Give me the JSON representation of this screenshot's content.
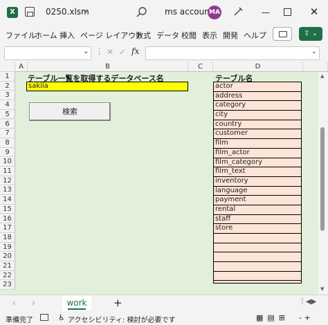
{
  "titlebar": {
    "logo": "X",
    "filename": "0250.xlsm",
    "account": "ms account",
    "avatar_initials": "MA",
    "minimize": "—",
    "close": "✕",
    "dropdown": "⌄"
  },
  "ribbon": {
    "tabs": [
      "ファイル",
      "ホーム",
      "挿入",
      "ページ レイアウト",
      "数式",
      "データ",
      "校閲",
      "表示",
      "開発",
      "ヘルプ"
    ],
    "share_label": "⇪ ⌄"
  },
  "formula_bar": {
    "name_box_value": "",
    "formula_value": "",
    "fx": "fx",
    "cancel": "✕",
    "enter": "✓",
    "dots": "⋮",
    "expand": "⌄",
    "name_box_chevron": "⌄"
  },
  "grid": {
    "columns": [
      "A",
      "B",
      "C",
      "D"
    ],
    "rows": [
      "1",
      "2",
      "3",
      "4",
      "5",
      "6",
      "7",
      "8",
      "9",
      "10",
      "11",
      "12",
      "13",
      "14",
      "15",
      "16",
      "17",
      "18",
      "19",
      "20",
      "21",
      "22",
      "23"
    ],
    "title": "テーブル一覧を取得するデータベース名",
    "db_name_value": "sakila",
    "search_button_label": "検索",
    "table_header": "テーブル名",
    "tables": [
      "actor",
      "address",
      "category",
      "city",
      "country",
      "customer",
      "film",
      "film_actor",
      "film_category",
      "film_text",
      "inventory",
      "language",
      "payment",
      "rental",
      "staff",
      "store",
      "",
      "",
      "",
      "",
      ""
    ]
  },
  "sheets": {
    "prev": "‹",
    "next": "›",
    "active": "work",
    "add": "+",
    "more": "⋮◀▶"
  },
  "statusbar": {
    "ready": "準備完了",
    "accessibility": "アクセシビリティ: 検討が必要です",
    "accessibility_icon": "♿",
    "views": "▦▤⊞",
    "zoom": "- +"
  },
  "colors": {
    "sheet_bg": "#e2efda",
    "db_cell": "#ffff00",
    "table_list_bg": "#fce4d6",
    "excel_green": "#1e7145"
  }
}
